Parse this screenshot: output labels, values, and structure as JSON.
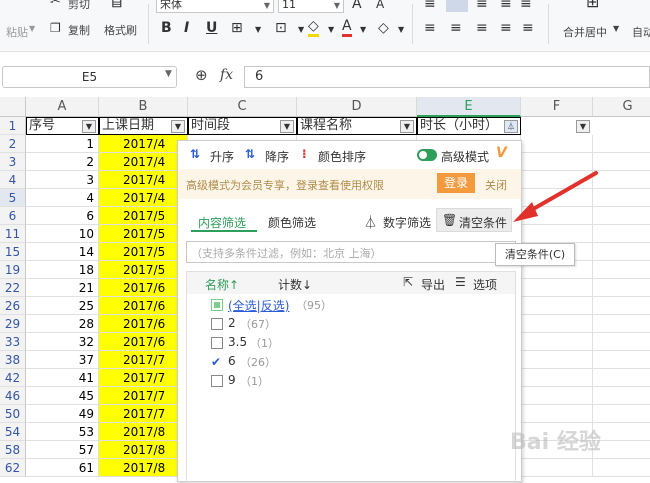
{
  "ribbon": {
    "cut_label": "剪切",
    "copy_label": "复制",
    "paste_label": "粘贴",
    "format_painter_label": "格式刷",
    "font_name": "宋体",
    "font_size": "11",
    "merge_center_label": "合并居中",
    "auto_label": "自动"
  },
  "formula_bar": {
    "cell_ref": "E5",
    "fx_label": "fx",
    "value": "6"
  },
  "columns": [
    "A",
    "B",
    "C",
    "D",
    "E",
    "F",
    "G"
  ],
  "headers": [
    "序号",
    "上课日期",
    "时间段",
    "课程名称",
    "时长（小时）"
  ],
  "rows": [
    {
      "row": "1"
    },
    {
      "row": "2",
      "seq": "1",
      "date": "2017/4"
    },
    {
      "row": "3",
      "seq": "2",
      "date": "2017/4"
    },
    {
      "row": "4",
      "seq": "3",
      "date": "2017/4"
    },
    {
      "row": "5",
      "seq": "4",
      "date": "2017/4"
    },
    {
      "row": "6",
      "seq": "6",
      "date": "2017/5"
    },
    {
      "row": "11",
      "seq": "10",
      "date": "2017/5"
    },
    {
      "row": "15",
      "seq": "14",
      "date": "2017/5"
    },
    {
      "row": "19",
      "seq": "18",
      "date": "2017/5"
    },
    {
      "row": "22",
      "seq": "21",
      "date": "2017/6"
    },
    {
      "row": "26",
      "seq": "25",
      "date": "2017/6"
    },
    {
      "row": "29",
      "seq": "28",
      "date": "2017/6"
    },
    {
      "row": "33",
      "seq": "32",
      "date": "2017/6"
    },
    {
      "row": "38",
      "seq": "37",
      "date": "2017/7"
    },
    {
      "row": "42",
      "seq": "41",
      "date": "2017/7"
    },
    {
      "row": "46",
      "seq": "45",
      "date": "2017/7"
    },
    {
      "row": "50",
      "seq": "49",
      "date": "2017/7"
    },
    {
      "row": "54",
      "seq": "53",
      "date": "2017/8"
    },
    {
      "row": "58",
      "seq": "57",
      "date": "2017/8"
    },
    {
      "row": "62",
      "seq": "61",
      "date": "2017/8"
    }
  ],
  "filter_panel": {
    "sort_asc": "升序",
    "sort_desc": "降序",
    "color_sort": "颜色排序",
    "advanced_mode": "高级模式",
    "member_notice": "高级模式为会员专享，登录查看使用权限",
    "login_button": "登录",
    "close_button": "关闭",
    "tab_content": "内容筛选",
    "tab_color": "颜色筛选",
    "number_filter": "数字筛选",
    "clear_condition": "清空条件",
    "search_placeholder": "（支持多条件过滤，例如：北京 上海）",
    "col_name": "名称↑",
    "col_count": "计数↓",
    "export": "导出",
    "options": "选项",
    "items": [
      {
        "label": "(全选|反选)",
        "count": "（95）",
        "checked": "partial"
      },
      {
        "label": "2",
        "count": "（67）",
        "checked": "no"
      },
      {
        "label": "3.5",
        "count": "（1）",
        "checked": "no"
      },
      {
        "label": "6",
        "count": "（26）",
        "checked": "yes"
      },
      {
        "label": "9",
        "count": "（1）",
        "checked": "no"
      }
    ]
  },
  "tooltip": "清空条件(C)",
  "watermark": "Bai 经验",
  "colors": {
    "highlight_yellow": "#ffff00",
    "accent_green": "#2e9e5b",
    "login_orange": "#f39a3d",
    "arrow_red": "#e0312b"
  }
}
